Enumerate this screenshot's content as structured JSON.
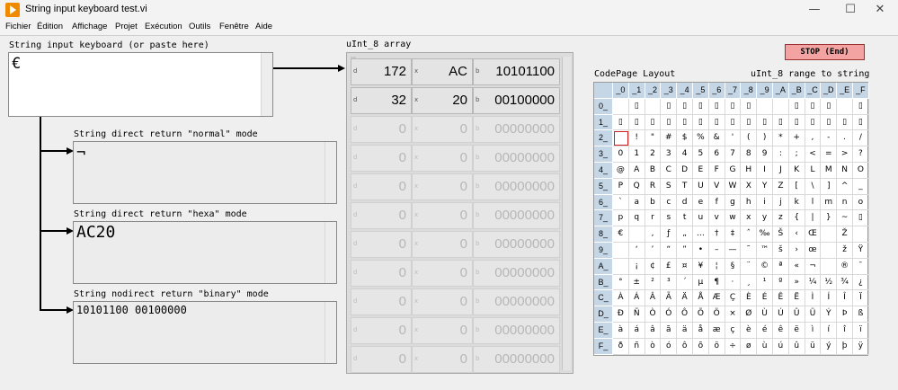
{
  "window": {
    "title": "String input keyboard test.vi",
    "controls": {
      "minimize": "—",
      "maximize": "☐",
      "close": "✕"
    }
  },
  "menu": [
    "Fichier",
    "Édition",
    "Affichage",
    "Projet",
    "Exécution",
    "Outils",
    "Fenêtre",
    "Aide"
  ],
  "input": {
    "label": "String input keyboard (or paste here)",
    "value": "€"
  },
  "normal": {
    "label": "String direct return \"normal\" mode",
    "value": "¬"
  },
  "hexa": {
    "label": "String direct return \"hexa\" mode",
    "value": "AC20"
  },
  "binary": {
    "label": "String nodirect return \"binary\" mode",
    "value": "10101100 00100000"
  },
  "array": {
    "label": "uInt_8 array",
    "radix": {
      "dec": "d",
      "hex": "x",
      "bin": "b"
    },
    "rows": [
      {
        "dec": "172",
        "hex": "AC",
        "bin": "10101100"
      },
      {
        "dec": "32",
        "hex": "20",
        "bin": "00100000"
      },
      {
        "dec": "0",
        "hex": "0",
        "bin": "00000000"
      },
      {
        "dec": "0",
        "hex": "0",
        "bin": "00000000"
      },
      {
        "dec": "0",
        "hex": "0",
        "bin": "00000000"
      },
      {
        "dec": "0",
        "hex": "0",
        "bin": "00000000"
      },
      {
        "dec": "0",
        "hex": "0",
        "bin": "00000000"
      },
      {
        "dec": "0",
        "hex": "0",
        "bin": "00000000"
      },
      {
        "dec": "0",
        "hex": "0",
        "bin": "00000000"
      },
      {
        "dec": "0",
        "hex": "0",
        "bin": "00000000"
      },
      {
        "dec": "0",
        "hex": "0",
        "bin": "00000000"
      }
    ]
  },
  "stop_button": {
    "label": "STOP (End)",
    "color": "#f4a3a3"
  },
  "codepage": {
    "label": "CodePage Layout",
    "range_label": "uInt_8 range to string",
    "col_headers": [
      "_0",
      "_1",
      "_2",
      "_3",
      "_4",
      "_5",
      "_6",
      "_7",
      "_8",
      "_9",
      "_A",
      "_B",
      "_C",
      "_D",
      "_E",
      "_F"
    ],
    "row_headers": [
      "0_",
      "1_",
      "2_",
      "3_",
      "4_",
      "5_",
      "6_",
      "7_",
      "8_",
      "9_",
      "A_",
      "B_",
      "C_",
      "D_",
      "E_",
      "F_"
    ],
    "rows": [
      [
        "",
        "▯",
        "",
        "▯",
        "▯",
        "▯",
        "▯",
        "▯",
        "▯",
        "",
        "",
        "▯",
        "▯",
        "▯",
        "",
        "▯"
      ],
      [
        "▯",
        "▯",
        "▯",
        "▯",
        "▯",
        "▯",
        "▯",
        "▯",
        "▯",
        "▯",
        "▯",
        "▯",
        "▯",
        "▯",
        "▯",
        "▯"
      ],
      [
        "",
        "!",
        "\"",
        "#",
        "$",
        "%",
        "&",
        "'",
        "(",
        ")",
        "*",
        "+",
        ",",
        "-",
        ".",
        "/"
      ],
      [
        "0",
        "1",
        "2",
        "3",
        "4",
        "5",
        "6",
        "7",
        "8",
        "9",
        ":",
        ";",
        "<",
        "=",
        ">",
        "?"
      ],
      [
        "@",
        "A",
        "B",
        "C",
        "D",
        "E",
        "F",
        "G",
        "H",
        "I",
        "J",
        "K",
        "L",
        "M",
        "N",
        "O"
      ],
      [
        "P",
        "Q",
        "R",
        "S",
        "T",
        "U",
        "V",
        "W",
        "X",
        "Y",
        "Z",
        "[",
        "\\",
        "]",
        "^",
        "_"
      ],
      [
        "`",
        "a",
        "b",
        "c",
        "d",
        "e",
        "f",
        "g",
        "h",
        "i",
        "j",
        "k",
        "l",
        "m",
        "n",
        "o"
      ],
      [
        "p",
        "q",
        "r",
        "s",
        "t",
        "u",
        "v",
        "w",
        "x",
        "y",
        "z",
        "{",
        "|",
        "}",
        "~",
        "▯"
      ],
      [
        "€",
        "",
        "‚",
        "ƒ",
        "„",
        "…",
        "†",
        "‡",
        "ˆ",
        "‰",
        "Š",
        "‹",
        "Œ",
        "",
        "Ž",
        ""
      ],
      [
        "",
        "‘",
        "’",
        "“",
        "”",
        "•",
        "–",
        "—",
        "˜",
        "™",
        "š",
        "›",
        "œ",
        "",
        "ž",
        "Ÿ"
      ],
      [
        "",
        "¡",
        "¢",
        "£",
        "¤",
        "¥",
        "¦",
        "§",
        "¨",
        "©",
        "ª",
        "«",
        "¬",
        "",
        "®",
        "¯"
      ],
      [
        "°",
        "±",
        "²",
        "³",
        "´",
        "µ",
        "¶",
        "·",
        "¸",
        "¹",
        "º",
        "»",
        "¼",
        "½",
        "¾",
        "¿"
      ],
      [
        "À",
        "Á",
        "Â",
        "Ã",
        "Ä",
        "Å",
        "Æ",
        "Ç",
        "È",
        "É",
        "Ê",
        "Ë",
        "Ì",
        "Í",
        "Î",
        "Ï"
      ],
      [
        "Ð",
        "Ñ",
        "Ò",
        "Ó",
        "Ô",
        "Õ",
        "Ö",
        "×",
        "Ø",
        "Ù",
        "Ú",
        "Û",
        "Ü",
        "Ý",
        "Þ",
        "ß"
      ],
      [
        "à",
        "á",
        "â",
        "ã",
        "ä",
        "å",
        "æ",
        "ç",
        "è",
        "é",
        "ê",
        "ë",
        "ì",
        "í",
        "î",
        "ï"
      ],
      [
        "ð",
        "ñ",
        "ò",
        "ó",
        "ô",
        "õ",
        "ö",
        "÷",
        "ø",
        "ù",
        "ú",
        "û",
        "ü",
        "ý",
        "þ",
        "ÿ"
      ]
    ]
  }
}
